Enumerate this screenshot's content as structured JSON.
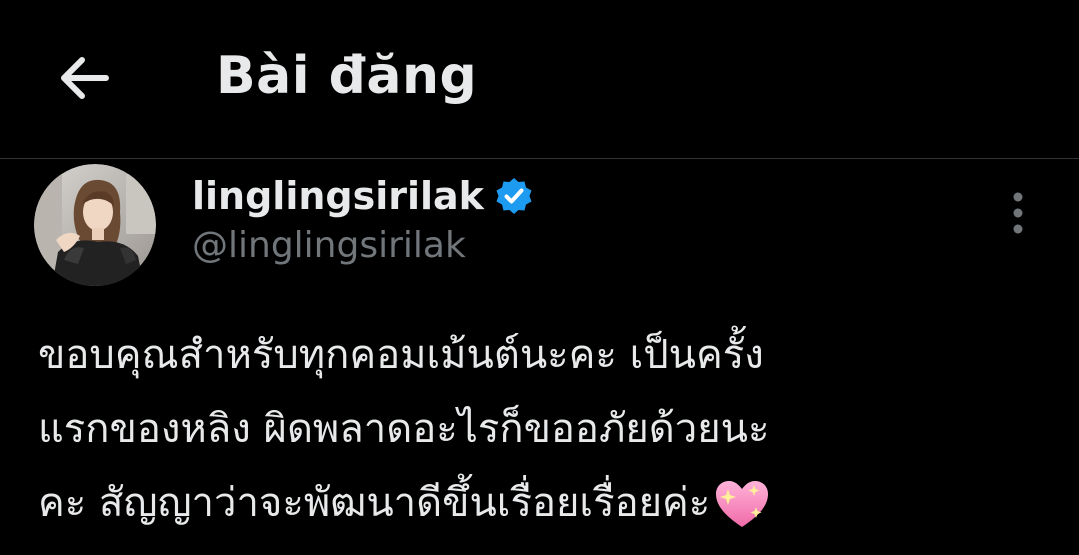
{
  "header": {
    "title": "Bài đăng",
    "back_icon": "arrow-left-icon"
  },
  "post": {
    "author": {
      "display_name": "linglingsirilak",
      "handle": "@linglingsirilak",
      "verified": true,
      "verified_color": "#1d9bf0",
      "avatar_icon": "profile-photo"
    },
    "more_icon": "vertical-ellipsis-icon",
    "text": "ขอบคุณสำหรับทุกคอมเม้นต์นะคะ เป็นครั้ง\nแรกของหลิง ผิดพลาดอะไรก็ขออภัยด้วยนะ\nคะ สัญญาว่าจะพัฒนาดีขึ้นเรื่อยเรื่อยค่ะ",
    "emoji": "sparkling-heart-icon"
  },
  "colors": {
    "background": "#000000",
    "text_primary": "#e7e9ea",
    "text_secondary": "#71767b",
    "divider": "#2f3336",
    "accent": "#1d9bf0"
  }
}
